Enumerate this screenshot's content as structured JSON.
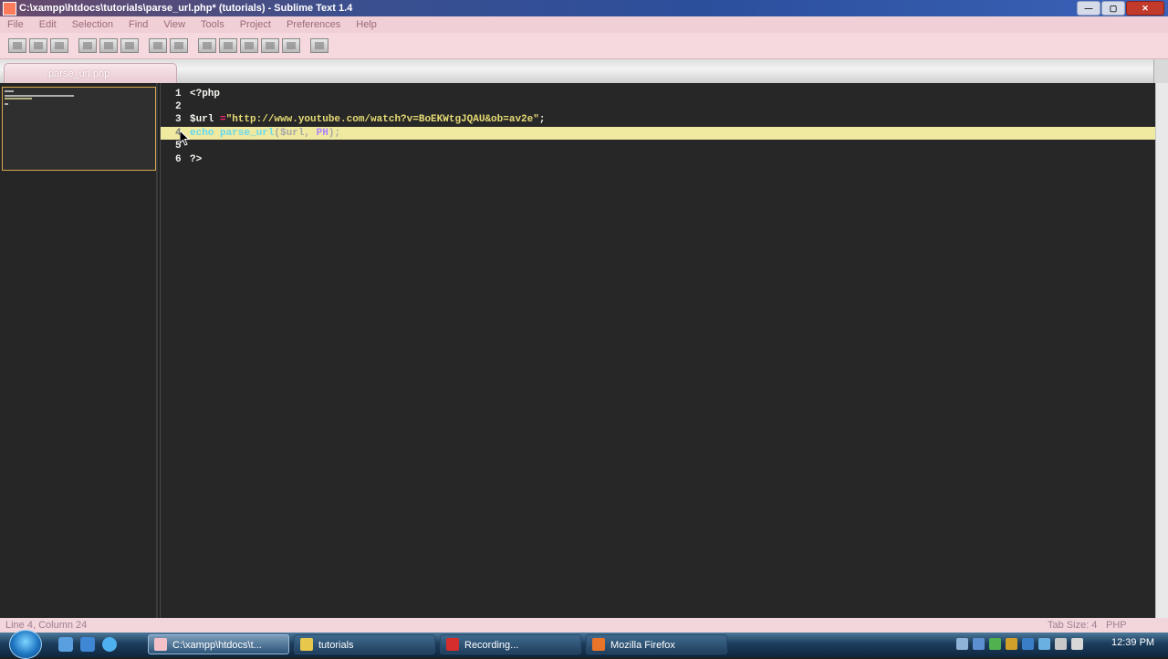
{
  "window": {
    "title": "C:\\xampp\\htdocs\\tutorials\\parse_url.php* (tutorials) - Sublime Text 1.4",
    "buttons": {
      "minimize": "—",
      "maximize": "▢",
      "close": "✕"
    }
  },
  "menu": [
    "File",
    "Edit",
    "Selection",
    "Find",
    "View",
    "Tools",
    "Project",
    "Preferences",
    "Help"
  ],
  "tab": {
    "label": "parse_url.php"
  },
  "code": {
    "lines": [
      {
        "num": "1",
        "text": "<?php"
      },
      {
        "num": "2",
        "text": ""
      },
      {
        "num": "3",
        "var": "$url",
        "op": " =",
        "str": "\"http://www.youtube.com/watch?v=BoEKWtgJQAU&ob=av2e\"",
        "end": ";"
      },
      {
        "num": "4",
        "fn": "echo parse_url",
        "args": "($url, ",
        "arg2": "PH",
        "close": ");"
      },
      {
        "num": "5",
        "text": ""
      },
      {
        "num": "6",
        "text": "?>"
      }
    ]
  },
  "statusbar": {
    "position": "Line 4, Column 24",
    "tab_size": "Tab Size: 4",
    "syntax": "PHP"
  },
  "taskbar": {
    "tasks": [
      {
        "label": "C:\\xampp\\htdocs\\t...",
        "color": "#f4c1c8"
      },
      {
        "label": "tutorials",
        "color": "#e8c84a"
      },
      {
        "label": "Recording...",
        "color": "#d62d2d"
      },
      {
        "label": "Mozilla Firefox",
        "color": "#e8742a"
      }
    ],
    "clock": "12:39 PM"
  }
}
